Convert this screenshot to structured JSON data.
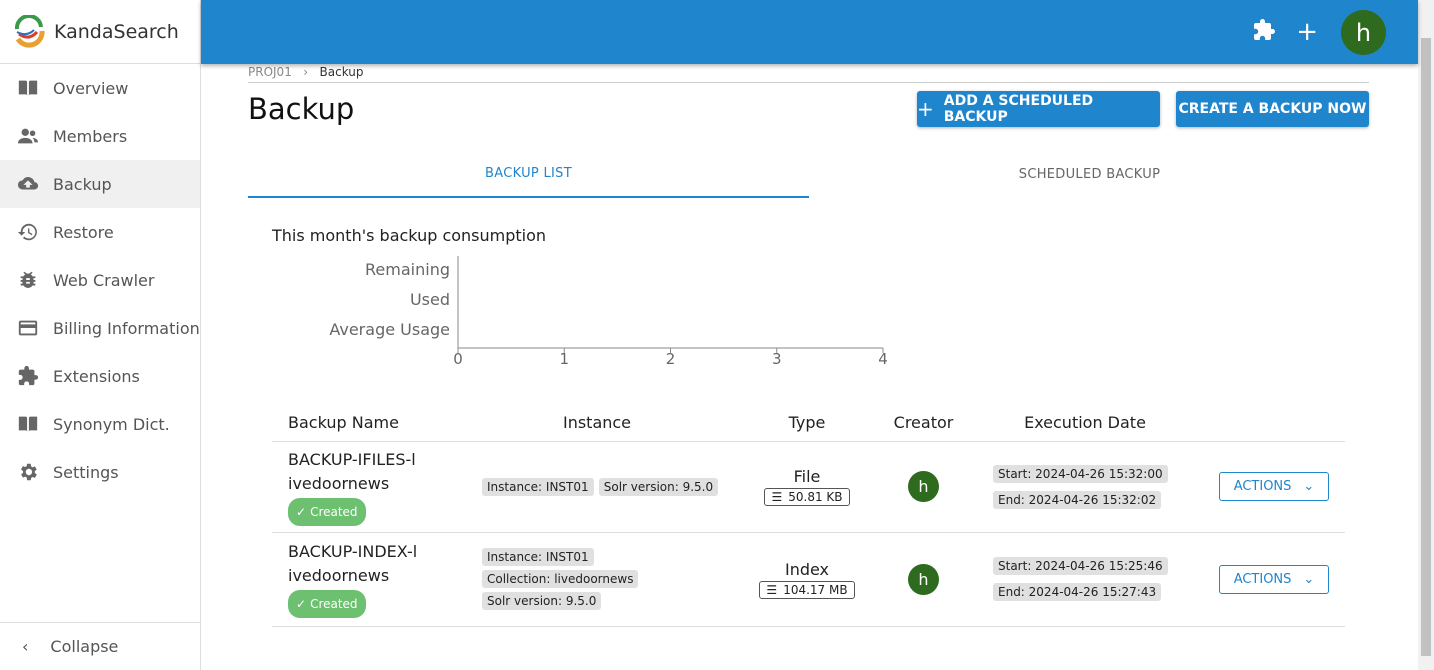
{
  "brand": "KandaSearch",
  "sidebar": {
    "items": [
      {
        "label": "Overview",
        "icon": "book-icon"
      },
      {
        "label": "Members",
        "icon": "people-icon"
      },
      {
        "label": "Backup",
        "icon": "cloud-upload-icon"
      },
      {
        "label": "Restore",
        "icon": "history-icon"
      },
      {
        "label": "Web Crawler",
        "icon": "bug-icon"
      },
      {
        "label": "Billing Information",
        "icon": "credit-card-icon"
      },
      {
        "label": "Extensions",
        "icon": "puzzle-icon"
      },
      {
        "label": "Synonym Dict.",
        "icon": "book-icon"
      },
      {
        "label": "Settings",
        "icon": "gear-icon"
      }
    ],
    "collapse": "Collapse"
  },
  "header": {
    "avatar": "h"
  },
  "breadcrumb": [
    "PROJ01",
    "Backup"
  ],
  "page_title": "Backup",
  "buttons": {
    "add_scheduled": "ADD A SCHEDULED BACKUP",
    "create_now": "CREATE A BACKUP NOW"
  },
  "tabs": [
    "BACKUP LIST",
    "SCHEDULED BACKUP"
  ],
  "chart_data": {
    "type": "bar",
    "orientation": "horizontal",
    "title": "This month's backup consumption",
    "categories": [
      "Remaining",
      "Used",
      "Average Usage"
    ],
    "values": [],
    "xlim": [
      0,
      4
    ],
    "xticks": [
      "0",
      "1",
      "2",
      "3",
      "4"
    ]
  },
  "table": {
    "headers": [
      "Backup Name",
      "Instance",
      "Type",
      "Creator",
      "Execution Date"
    ],
    "rows": [
      {
        "name": "BACKUP-IFILES-livedoornews",
        "status": "Created",
        "chips": [
          "Instance:  INST01",
          "Solr version:  9.5.0"
        ],
        "type": "File",
        "size": "50.81 KB",
        "creator": "h",
        "start": "Start:  2024-04-26 15:32:00",
        "end": "End:  2024-04-26 15:32:02",
        "action": "ACTIONS"
      },
      {
        "name": "BACKUP-INDEX-livedoornews",
        "status": "Created",
        "chips": [
          "Instance:  INST01",
          "Collection:  livedoornews",
          "Solr version:  9.5.0"
        ],
        "type": "Index",
        "size": "104.17 MB",
        "creator": "h",
        "start": "Start:  2024-04-26 15:25:46",
        "end": "End:  2024-04-26 15:27:43",
        "action": "ACTIONS"
      }
    ]
  }
}
